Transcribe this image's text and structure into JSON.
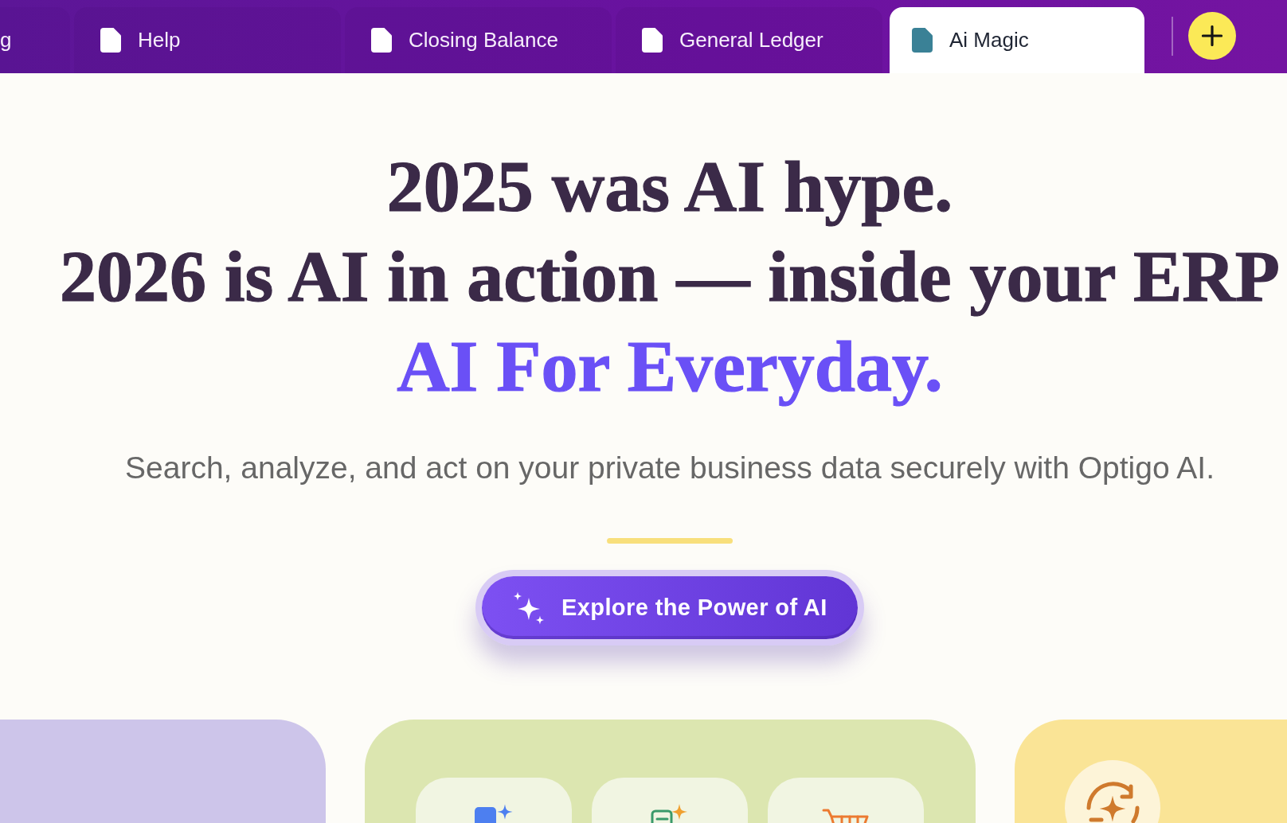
{
  "tabs": [
    {
      "label": "g",
      "selected": false,
      "icon": false
    },
    {
      "label": "Help",
      "selected": false,
      "icon": true
    },
    {
      "label": "Closing Balance",
      "selected": false,
      "icon": true
    },
    {
      "label": "General Ledger",
      "selected": false,
      "icon": true
    },
    {
      "label": "Ai Magic",
      "selected": true,
      "icon": true
    }
  ],
  "hero": {
    "headline": [
      {
        "text": "2025 was AI hype.",
        "accent": false
      },
      {
        "text": "2026 is AI in action — inside your ERP",
        "accent": false
      },
      {
        "text": "AI For Everyday.",
        "accent": true
      }
    ],
    "subtitle": "Search, analyze, and act on your private business data securely with Optigo AI.",
    "cta_button": {
      "label": "Explore the Power of AI"
    }
  },
  "cards": [
    {
      "kind": "plain",
      "color": "#cdc5ea"
    },
    {
      "kind": "tiles",
      "color": "#dce6b0"
    },
    {
      "kind": "emblem",
      "color": "#fae496"
    }
  ]
}
